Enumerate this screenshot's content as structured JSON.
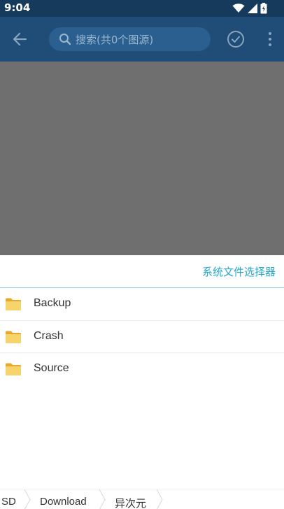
{
  "status_bar": {
    "time": "9:04"
  },
  "app_bar": {
    "search_placeholder": "搜索(共0个图源)"
  },
  "sheet": {
    "picker_link": "系统文件选择器",
    "folders": [
      {
        "name": "Backup"
      },
      {
        "name": "Crash"
      },
      {
        "name": "Source"
      }
    ]
  },
  "breadcrumb": {
    "items": [
      "SD",
      "Download",
      "异次元"
    ]
  },
  "colors": {
    "app_bar": "#1f4d77",
    "status_bar": "#163a5c",
    "accent": "#26a7c9",
    "scrim": "#6f6f6f",
    "folder": "#f3c65a"
  }
}
